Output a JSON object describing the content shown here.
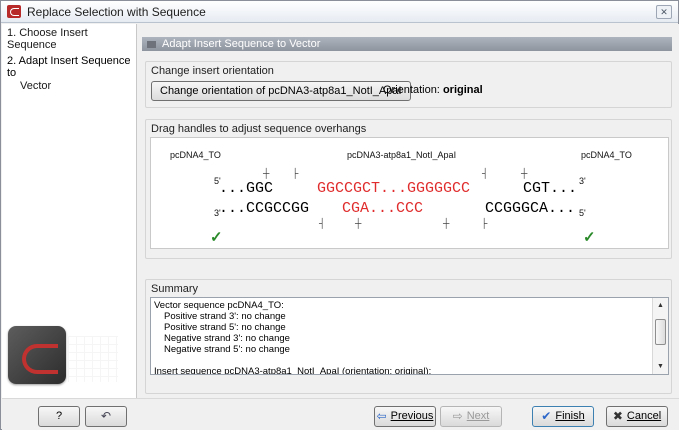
{
  "window": {
    "title": "Replace Selection with Sequence"
  },
  "sidebar": {
    "steps": [
      {
        "label": "1. Choose Insert Sequence"
      },
      {
        "label": "2. Adapt Insert Sequence to"
      },
      {
        "label": "Vector"
      }
    ]
  },
  "main": {
    "section_title": "Adapt Insert Sequence to Vector",
    "orientation_panel": {
      "title": "Change insert orientation",
      "button_label": "Change orientation of pcDNA3-atp8a1_NotI_ApaI",
      "orientation_prefix": "Orientation:",
      "orientation_value": "original"
    },
    "overhang_panel": {
      "title": "Drag handles to adjust sequence overhangs",
      "left_vector": "pcDNA4_TO",
      "insert_name": "pcDNA3-atp8a1_NotI_ApaI",
      "right_vector": "pcDNA4_TO",
      "top_left_5": "5'",
      "top_right_3": "3'",
      "bottom_left_3": "3'",
      "bottom_right_5": "5'",
      "top_left_seq": "...GGC",
      "top_insert_seq": "GGCCGCT...GGGGGCC",
      "top_right_seq": "CGT...",
      "bottom_left_seq": "...CCGCCGG",
      "bottom_insert_seq": "CGA...CCC",
      "bottom_right_seq": "CCGGGCA...",
      "check_glyph": "✓",
      "colors": {
        "insert": "#e02c2c",
        "vector": "#000000",
        "check": "#2a8a2a"
      }
    },
    "summary_panel": {
      "title": "Summary",
      "lines": [
        "Vector sequence pcDNA4_TO:",
        "  Positive strand 3': no change",
        "  Positive strand 5': no change",
        "  Negative strand 3': no change",
        "  Negative strand 5': no change",
        "",
        "Insert sequence pcDNA3-atp8a1_NotI_ApaI (orientation: original):"
      ]
    }
  },
  "footer": {
    "help_label": "?",
    "reset_icon": "reset-icon",
    "previous_label": "Previous",
    "next_label": "Next",
    "finish_label": "Finish",
    "cancel_label": "Cancel"
  }
}
